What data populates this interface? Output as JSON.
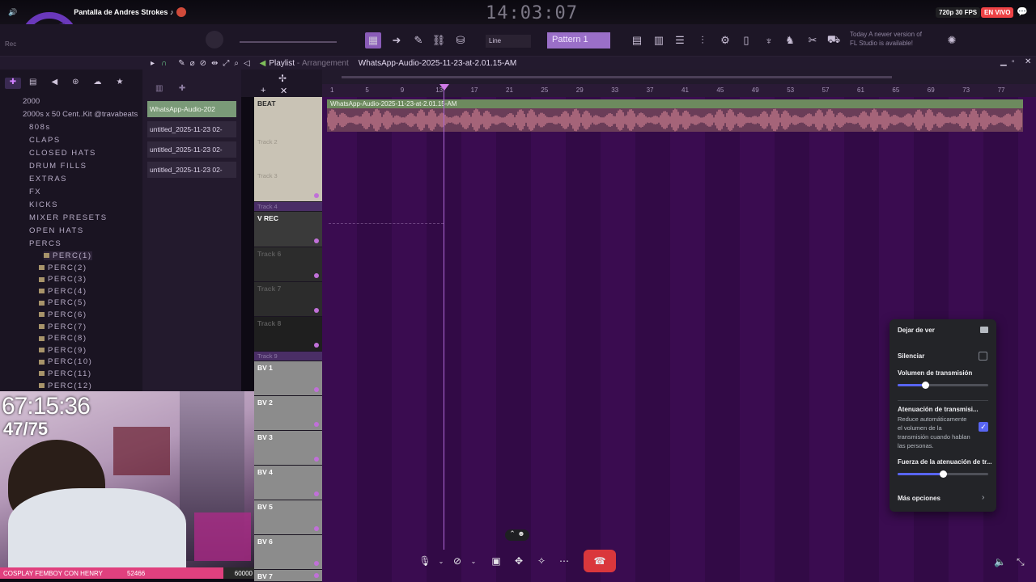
{
  "stream": {
    "title": "Pantalla de Andres Strokes ♪",
    "quality": "720p 30 FPS",
    "live": "EN VIVO"
  },
  "fl": {
    "clock": "14:03:07",
    "pattern": "Pattern 1",
    "snap": "Line",
    "rec_hint": "Rec",
    "news": [
      "Today  A newer version of",
      "FL Studio is available!"
    ]
  },
  "playlist": {
    "title": "Playlist",
    "sep": " - ",
    "mode": "Arrangement",
    "file": "WhatsApp-Audio-2025-11-23-at-2.01.15-AM",
    "ruler": [
      "1",
      "5",
      "9",
      "13",
      "17",
      "21",
      "25",
      "29",
      "33",
      "37",
      "41",
      "45",
      "49",
      "53",
      "57",
      "61",
      "65",
      "69",
      "73",
      "77"
    ],
    "clip_title": "WhatsApp-Audio-2025-11-23-at-2.01.15-AM"
  },
  "browser": {
    "items": [
      {
        "label": "2000",
        "plain": true
      },
      {
        "label": "2000s x 50 Cent..Kit @travabeats",
        "plain": true
      },
      {
        "label": "808s"
      },
      {
        "label": "CLAPS"
      },
      {
        "label": "CLOSED HATS"
      },
      {
        "label": "DRUM FILLS"
      },
      {
        "label": "EXTRAS"
      },
      {
        "label": "FX"
      },
      {
        "label": "KICKS"
      },
      {
        "label": "MIXER PRESETS"
      },
      {
        "label": "OPEN HATS"
      },
      {
        "label": "PERCS"
      }
    ],
    "files": [
      "PERC(1)",
      "PERC(2)",
      "PERC(3)",
      "PERC(4)",
      "PERC(5)",
      "PERC(6)",
      "PERC(7)",
      "PERC(8)",
      "PERC(9)",
      "PERC(10)",
      "PERC(11)",
      "PERC(12)"
    ]
  },
  "clips": [
    "WhatsApp-Audio-202",
    "untitled_2025-11-23 02-",
    "untitled_2025-11-23 02-",
    "untitled_2025-11-23 02-"
  ],
  "tracks": [
    {
      "name": "BEAT"
    },
    {
      "name": "Track 2"
    },
    {
      "name": "Track 3"
    },
    {
      "name": "Track 4"
    },
    {
      "name": "V REC"
    },
    {
      "name": "Track 6"
    },
    {
      "name": "Track 7"
    },
    {
      "name": "Track 8"
    },
    {
      "name": "Track 9"
    },
    {
      "name": "BV 1"
    },
    {
      "name": "BV 2"
    },
    {
      "name": "BV 3"
    },
    {
      "name": "BV 4"
    },
    {
      "name": "BV 5"
    },
    {
      "name": "BV 6"
    },
    {
      "name": "BV 7"
    }
  ],
  "overlay": {
    "timer": "67:15:36",
    "count": "47/75",
    "ticker": "COSPLAY FEMBOY CON HENRY",
    "ticker_count": "52466",
    "goal": "60000"
  },
  "popover": {
    "stop_watching": "Dejar de ver",
    "mute": "Silenciar",
    "volume": "Volumen de transmisión",
    "volume_level": 0.3,
    "attenuation": "Atenuación de transmisi...",
    "attenuation_desc": "Reduce automáticamente el volumen de la transmisión cuando hablan las personas.",
    "attenuation_on": true,
    "strength": "Fuerza de la atenuación de tr...",
    "strength_level": 0.5,
    "more": "Más opciones"
  },
  "colors": {
    "accent": "#5865f2",
    "live": "#ed4245",
    "end_call": "#da373c"
  }
}
